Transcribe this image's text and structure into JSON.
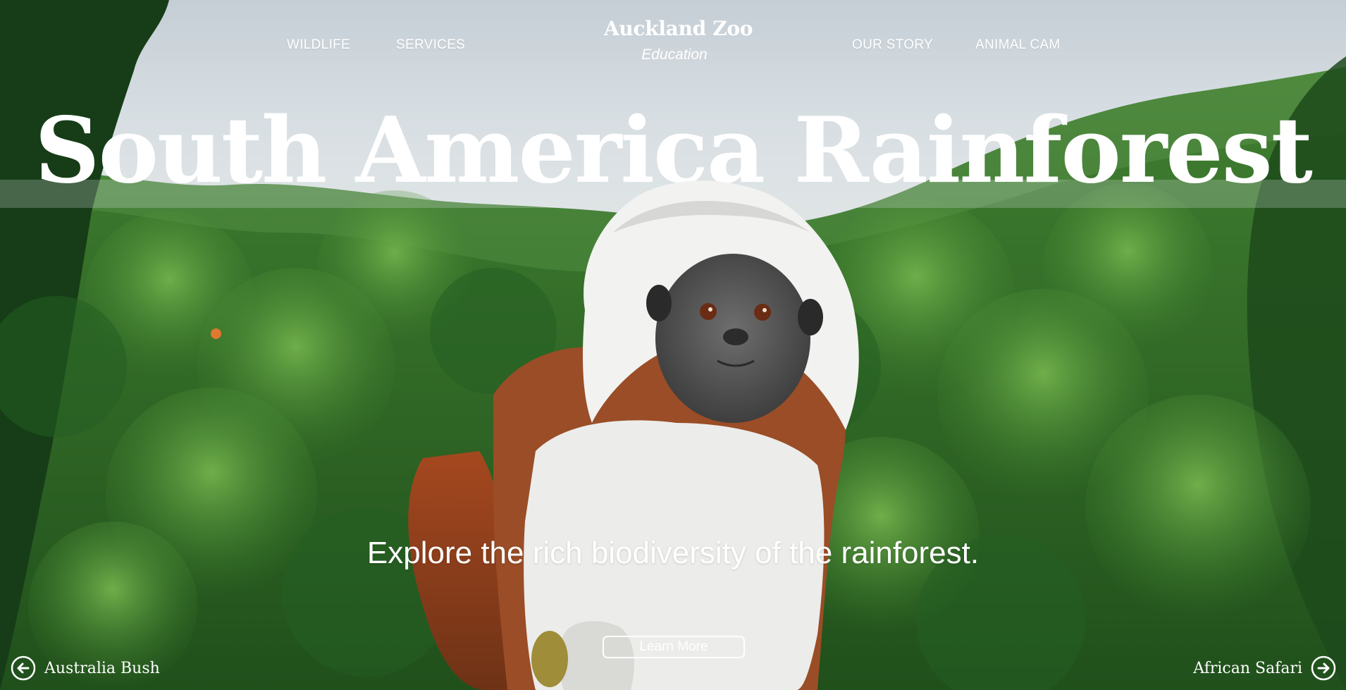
{
  "brand": {
    "title": "Auckland Zoo",
    "subtitle": "Education"
  },
  "nav": {
    "left": [
      {
        "label": "WILDLIFE"
      },
      {
        "label": "SERVICES"
      }
    ],
    "right": [
      {
        "label": "OUR STORY"
      },
      {
        "label": "ANIMAL CAM"
      }
    ]
  },
  "hero": {
    "title": "South America Rainforest",
    "subtitle": "Explore the rich biodiversity of the rainforest.",
    "cta_label": "Learn More"
  },
  "pager": {
    "prev_label": "Australia Bush",
    "prev_icon": "arrow-left-circle-icon",
    "next_label": "African Safari",
    "next_icon": "arrow-right-circle-icon"
  },
  "colors": {
    "text": "#ffffff",
    "accent_dot": "#e0782f",
    "foliage": "#2f6b2a"
  }
}
